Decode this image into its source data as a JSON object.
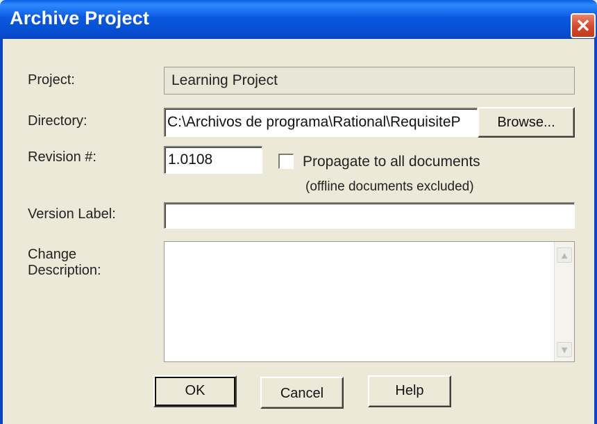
{
  "window": {
    "title": "Archive Project"
  },
  "form": {
    "project": {
      "label": "Project:",
      "value": "Learning Project"
    },
    "directory": {
      "label": "Directory:",
      "value": "C:\\Archivos de programa\\Rational\\RequisiteP",
      "browse_label": "Browse..."
    },
    "revision": {
      "label": "Revision #:",
      "value": "1.0108"
    },
    "propagate": {
      "label": "Propagate to all documents",
      "note": "(offline documents excluded)",
      "checked": false
    },
    "version_label": {
      "label": "Version Label:",
      "value": ""
    },
    "change_description": {
      "label_line1": "Change",
      "label_line2": "Description:",
      "value": ""
    }
  },
  "buttons": {
    "ok": "OK",
    "cancel": "Cancel",
    "help": "Help"
  },
  "icons": {
    "close": "close-icon",
    "scroll_up": "scroll-up-icon",
    "scroll_down": "scroll-down-icon"
  }
}
